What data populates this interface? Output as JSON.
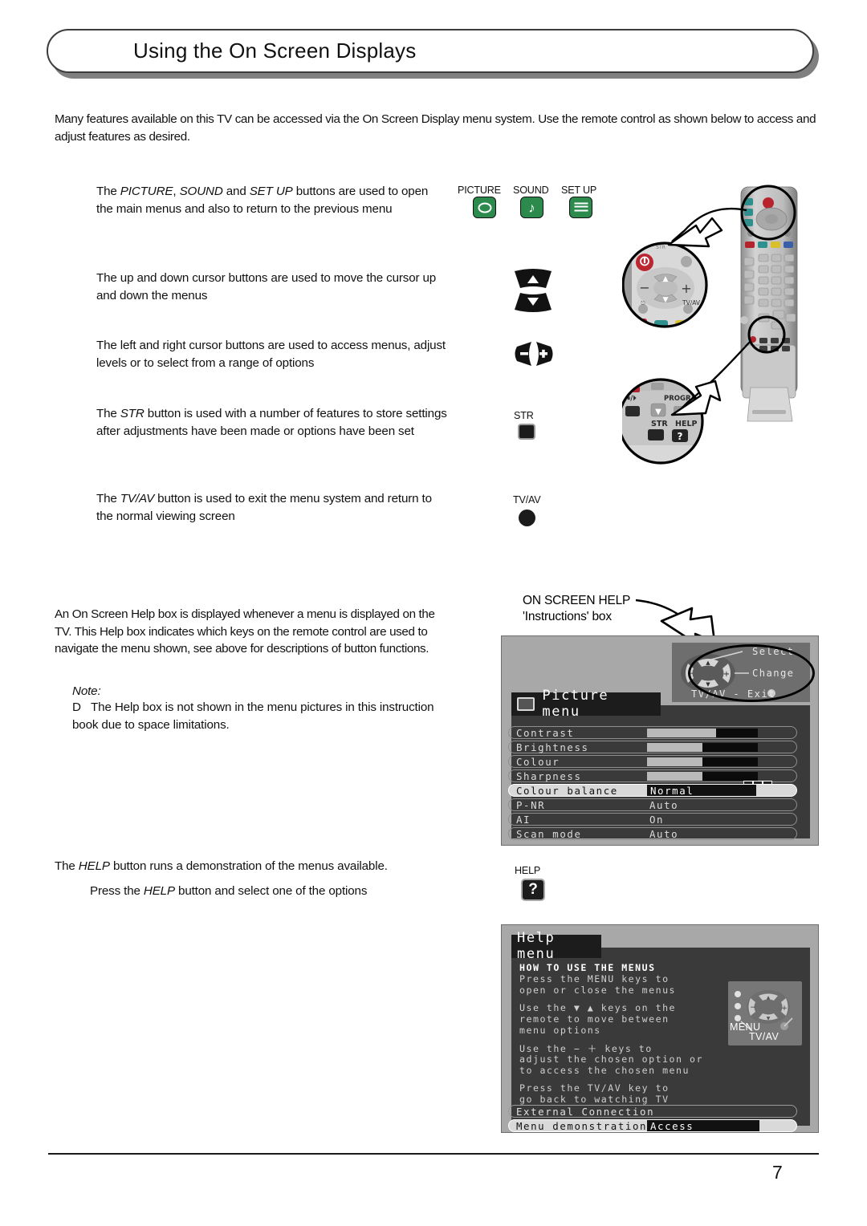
{
  "header": {
    "title": "Using the On Screen Displays"
  },
  "intro": "Many features available on this TV can be accessed via the On Screen Display menu system. Use the remote control as shown below to access and adjust features as desired.",
  "sections": [
    {
      "id": "picture-sound-setup",
      "text_html": "The <i>PICTURE</i>, <i>SOUND</i> and <i>SET UP</i> buttons are used to open the main menus and also to return to the previous menu",
      "buttons": [
        {
          "label": "PICTURE",
          "icon": "picture-screen-icon",
          "color": "#2c8a4d"
        },
        {
          "label": "SOUND",
          "icon": "music-note-icon",
          "color": "#2c8a4d"
        },
        {
          "label": "SET UP",
          "icon": "list-lines-icon",
          "color": "#2c8a4d"
        }
      ]
    },
    {
      "id": "up-down-cursor",
      "text_html": "The up and down cursor buttons are used to move the cursor up and down the menus",
      "icon": "cursor-up-down-icon"
    },
    {
      "id": "left-right-cursor",
      "text_html": "The left and right cursor buttons are used to access menus, adjust levels or to select from a range of options",
      "icon": "cursor-left-right-icon"
    },
    {
      "id": "str",
      "text_html": "The <i>STR</i> button is used with a number of features to store settings after adjustments have been made or options have been set",
      "button_label": "STR",
      "icon": "str-button-icon"
    },
    {
      "id": "tvav",
      "text_html": "The <i>TV/AV</i> button is used to exit the menu system and return to the normal viewing screen",
      "button_label": "TV/AV",
      "icon": "tvav-button-icon"
    }
  ],
  "help_box_para": "An On Screen Help box is displayed whenever a menu is displayed on the TV. This Help box indicates which keys on the remote control are used to navigate the menu shown, see above for descriptions of button functions.",
  "note": {
    "label": "Note:",
    "bullet": "D",
    "text": "The Help box is not shown in the menu pictures in this instruction book due to space limitations."
  },
  "on_screen_help_callout": {
    "line1": "ON SCREEN HELP",
    "line2": "'Instructions' box"
  },
  "picture_menu": {
    "title": "Picture menu",
    "help_overlay": {
      "select": "Select",
      "change": "Change",
      "exit": "TV/AV  - Exit"
    },
    "rows": [
      {
        "label": "Contrast",
        "type": "bar",
        "value": 62,
        "selected": false
      },
      {
        "label": "Brightness",
        "type": "bar",
        "value": 50,
        "selected": false
      },
      {
        "label": "Colour",
        "type": "bar",
        "value": 50,
        "selected": false
      },
      {
        "label": "Sharpness",
        "type": "bar",
        "value": 50,
        "selected": false
      },
      {
        "label": "Colour balance",
        "type": "option",
        "value": "Normal",
        "selected": true
      },
      {
        "label": "P-NR",
        "type": "option",
        "value": "Auto",
        "selected": false
      },
      {
        "label": "AI",
        "type": "option",
        "value": "On",
        "selected": false
      },
      {
        "label": "Scan mode",
        "type": "option",
        "value": "Auto",
        "selected": false
      }
    ]
  },
  "help_button": {
    "label": "HELP",
    "glyph": "?"
  },
  "help_lines": {
    "line1_html": "The <i>HELP</i> button runs a demonstration of the menus available.",
    "line2_html": "Press the <i>HELP</i> button and select one of the options"
  },
  "help_menu": {
    "title": "Help menu",
    "heading": "HOW TO USE THE MENUS",
    "paragraphs": [
      [
        "Press the MENU keys to",
        "open or close the menus"
      ],
      [
        "Use the ▼ ▲ keys on the",
        "remote to move between",
        "menu options"
      ],
      [
        "Use the − ＋ keys to",
        "adjust the chosen option or",
        "to access the chosen menu"
      ],
      [
        "Press the TV/AV key to",
        "go back to watching TV"
      ]
    ],
    "remote_labels": {
      "menu": "MENU",
      "tvav": "TV/AV"
    },
    "rows": [
      {
        "label": "External Connection",
        "value": "",
        "selected": false
      },
      {
        "label": "Menu demonstration",
        "value": "Access",
        "selected": true
      }
    ]
  },
  "footer": {
    "page_number": "7"
  }
}
